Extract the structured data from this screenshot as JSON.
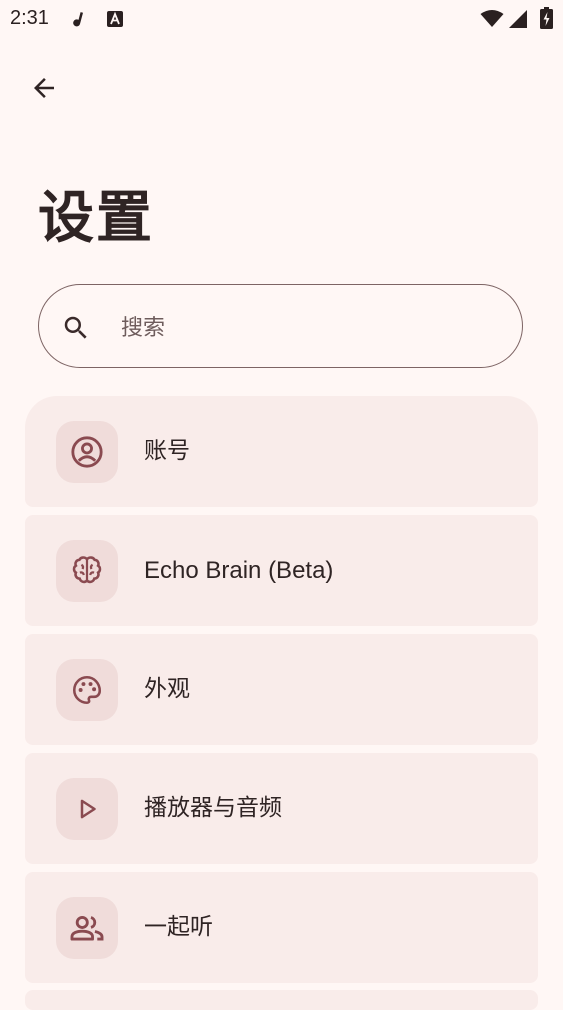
{
  "status_bar": {
    "time": "2:31",
    "notification_icons": [
      "music-note-icon",
      "font-a-icon"
    ],
    "system_icons": [
      "wifi-icon",
      "signal-icon",
      "battery-charging-icon"
    ]
  },
  "header": {
    "back_icon": "arrow-left-icon",
    "title": "设置"
  },
  "search": {
    "placeholder": "搜索",
    "icon": "search-icon"
  },
  "settings": {
    "items": [
      {
        "label": "账号",
        "icon": "account-circle-icon"
      },
      {
        "label": "Echo Brain (Beta)",
        "icon": "brain-icon"
      },
      {
        "label": "外观",
        "icon": "palette-icon"
      },
      {
        "label": "播放器与音频",
        "icon": "play-icon"
      },
      {
        "label": "一起听",
        "icon": "people-icon"
      }
    ]
  },
  "colors": {
    "background": "#fff7f5",
    "card": "#f9ecea",
    "icon_bg": "#f0dcda",
    "accent": "#8a4a50",
    "text": "#2f2424"
  }
}
